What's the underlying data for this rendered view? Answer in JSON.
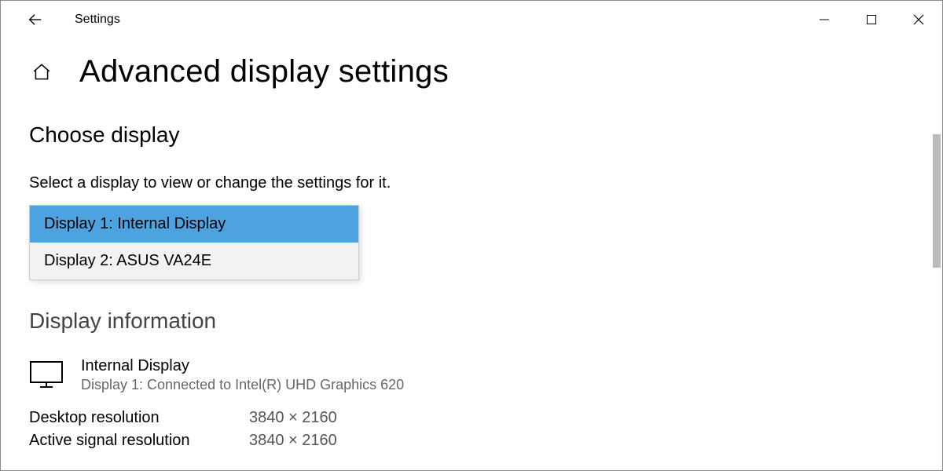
{
  "titlebar": {
    "app_title": "Settings"
  },
  "page": {
    "title": "Advanced display settings",
    "choose_heading": "Choose display",
    "instruction": "Select a display to view or change the settings for it.",
    "info_heading": "Display information"
  },
  "dropdown": {
    "options": [
      "Display 1: Internal Display",
      "Display 2: ASUS VA24E"
    ]
  },
  "display_info": {
    "name": "Internal Display",
    "connection": "Display 1: Connected to Intel(R) UHD Graphics 620",
    "rows": [
      {
        "label": "Desktop resolution",
        "value": "3840 × 2160"
      },
      {
        "label": "Active signal resolution",
        "value": "3840 × 2160"
      }
    ]
  }
}
